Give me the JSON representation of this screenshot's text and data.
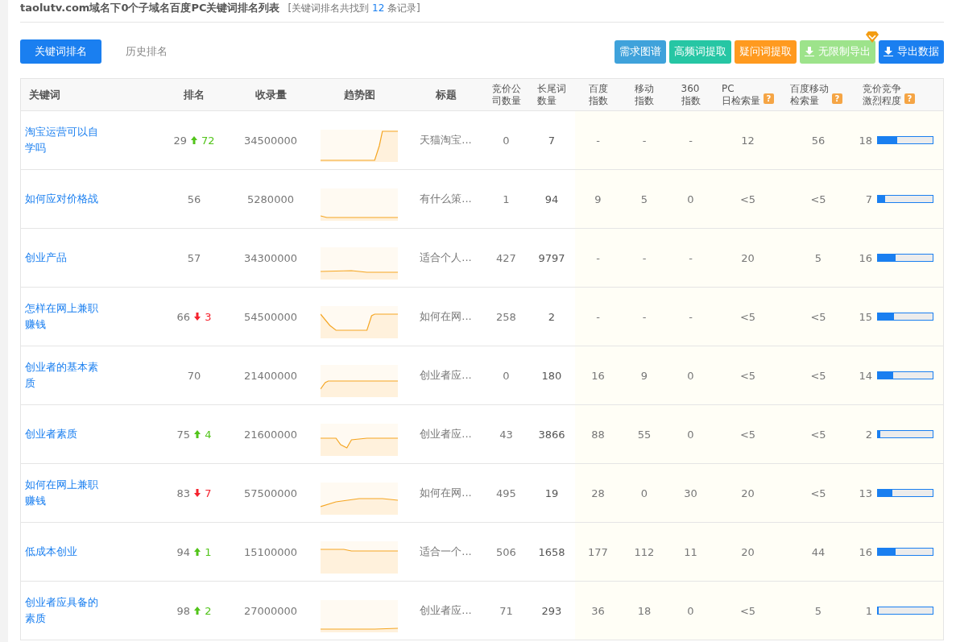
{
  "header": {
    "title": "taolutv.com域名下0个子域名百度PC关键词排名列表",
    "note_prefix": "[关键词排名共找到",
    "count": "12",
    "note_suffix": "条记录]"
  },
  "tabs": [
    {
      "label": "关键词排名",
      "selected": true
    },
    {
      "label": "历史排名",
      "selected": false
    }
  ],
  "actions": [
    {
      "label": "需求图谱",
      "color": "#3fa2db",
      "kind": "plain",
      "premium": false
    },
    {
      "label": "高频词提取",
      "color": "#26c6a4",
      "kind": "plain",
      "premium": false
    },
    {
      "label": "疑问词提取",
      "color": "#ff9a1f",
      "kind": "plain",
      "premium": false
    },
    {
      "label": "无限制导出",
      "color": "#9de38b",
      "kind": "download",
      "premium": true
    },
    {
      "label": "导出数据",
      "color": "#1a7ff0",
      "kind": "download",
      "premium": false
    }
  ],
  "table": {
    "columns": [
      {
        "lines": [
          "关键词"
        ]
      },
      {
        "lines": [
          "排名"
        ]
      },
      {
        "lines": [
          "收录量"
        ]
      },
      {
        "lines": [
          "趋势图"
        ]
      },
      {
        "lines": [
          "标题"
        ]
      },
      {
        "lines": [
          "竞价公",
          "司数量"
        ]
      },
      {
        "lines": [
          "长尾词",
          "数量"
        ]
      },
      {
        "lines": [
          "百度",
          "指数"
        ]
      },
      {
        "lines": [
          "移动",
          "指数"
        ]
      },
      {
        "lines": [
          "360",
          "指数"
        ]
      },
      {
        "lines": [
          "PC",
          "日检索量"
        ],
        "help": "?"
      },
      {
        "lines": [
          "百度移动",
          "检索量"
        ],
        "help": "?"
      },
      {
        "lines": [
          "竞价竞争",
          "激烈程度"
        ],
        "help": "?"
      }
    ],
    "rows": [
      {
        "keyword": "淘宝运营可以自学吗",
        "rank": "29",
        "change": "72",
        "kind": "up",
        "indexed": "34500000",
        "title": "天猫淘宝...",
        "metrics": [
          "0",
          "7",
          "-",
          "-",
          "-",
          "12",
          "56"
        ],
        "competition": "18",
        "level": 0.35
      },
      {
        "keyword": "如何应对价格战",
        "rank": "56",
        "kind": "none",
        "indexed": "5280000",
        "title": "有什么策...",
        "metrics": [
          "1",
          "94",
          "9",
          "5",
          "0",
          "<5",
          "<5"
        ],
        "competition": "7",
        "level": 0.13
      },
      {
        "keyword": "创业产品",
        "rank": "57",
        "kind": "none",
        "indexed": "34300000",
        "title": "适合个人...",
        "metrics": [
          "427",
          "9797",
          "-",
          "-",
          "-",
          "20",
          "5"
        ],
        "competition": "16",
        "level": 0.32
      },
      {
        "keyword": "怎样在网上兼职赚钱",
        "rank": "66",
        "change": "3",
        "kind": "down",
        "indexed": "54500000",
        "title": "如何在网...",
        "metrics": [
          "258",
          "2",
          "-",
          "-",
          "-",
          "<5",
          "<5"
        ],
        "competition": "15",
        "level": 0.3
      },
      {
        "keyword": "创业者的基本素质",
        "rank": "70",
        "kind": "none",
        "indexed": "21400000",
        "title": "创业者应...",
        "metrics": [
          "0",
          "180",
          "16",
          "9",
          "0",
          "<5",
          "<5"
        ],
        "competition": "14",
        "level": 0.28
      },
      {
        "keyword": "创业者素质",
        "rank": "75",
        "change": "4",
        "kind": "up",
        "indexed": "21600000",
        "title": "创业者应...",
        "metrics": [
          "43",
          "3866",
          "88",
          "55",
          "0",
          "<5",
          "<5"
        ],
        "competition": "2",
        "level": 0.04
      },
      {
        "keyword": "如何在网上兼职赚钱",
        "rank": "83",
        "change": "7",
        "kind": "down",
        "indexed": "57500000",
        "title": "如何在网...",
        "metrics": [
          "495",
          "19",
          "28",
          "0",
          "30",
          "20",
          "<5"
        ],
        "competition": "13",
        "level": 0.27
      },
      {
        "keyword": "低成本创业",
        "rank": "94",
        "change": "1",
        "kind": "up",
        "indexed": "15100000",
        "title": "适合一个...",
        "metrics": [
          "506",
          "1658",
          "177",
          "112",
          "11",
          "20",
          "44"
        ],
        "competition": "16",
        "level": 0.33
      },
      {
        "keyword": "创业者应具备的素质",
        "rank": "98",
        "change": "2",
        "kind": "up",
        "indexed": "27000000",
        "title": "创业者应...",
        "metrics": [
          "71",
          "293",
          "36",
          "18",
          "0",
          "<5",
          "5"
        ],
        "competition": "1",
        "level": 0.02
      }
    ]
  }
}
